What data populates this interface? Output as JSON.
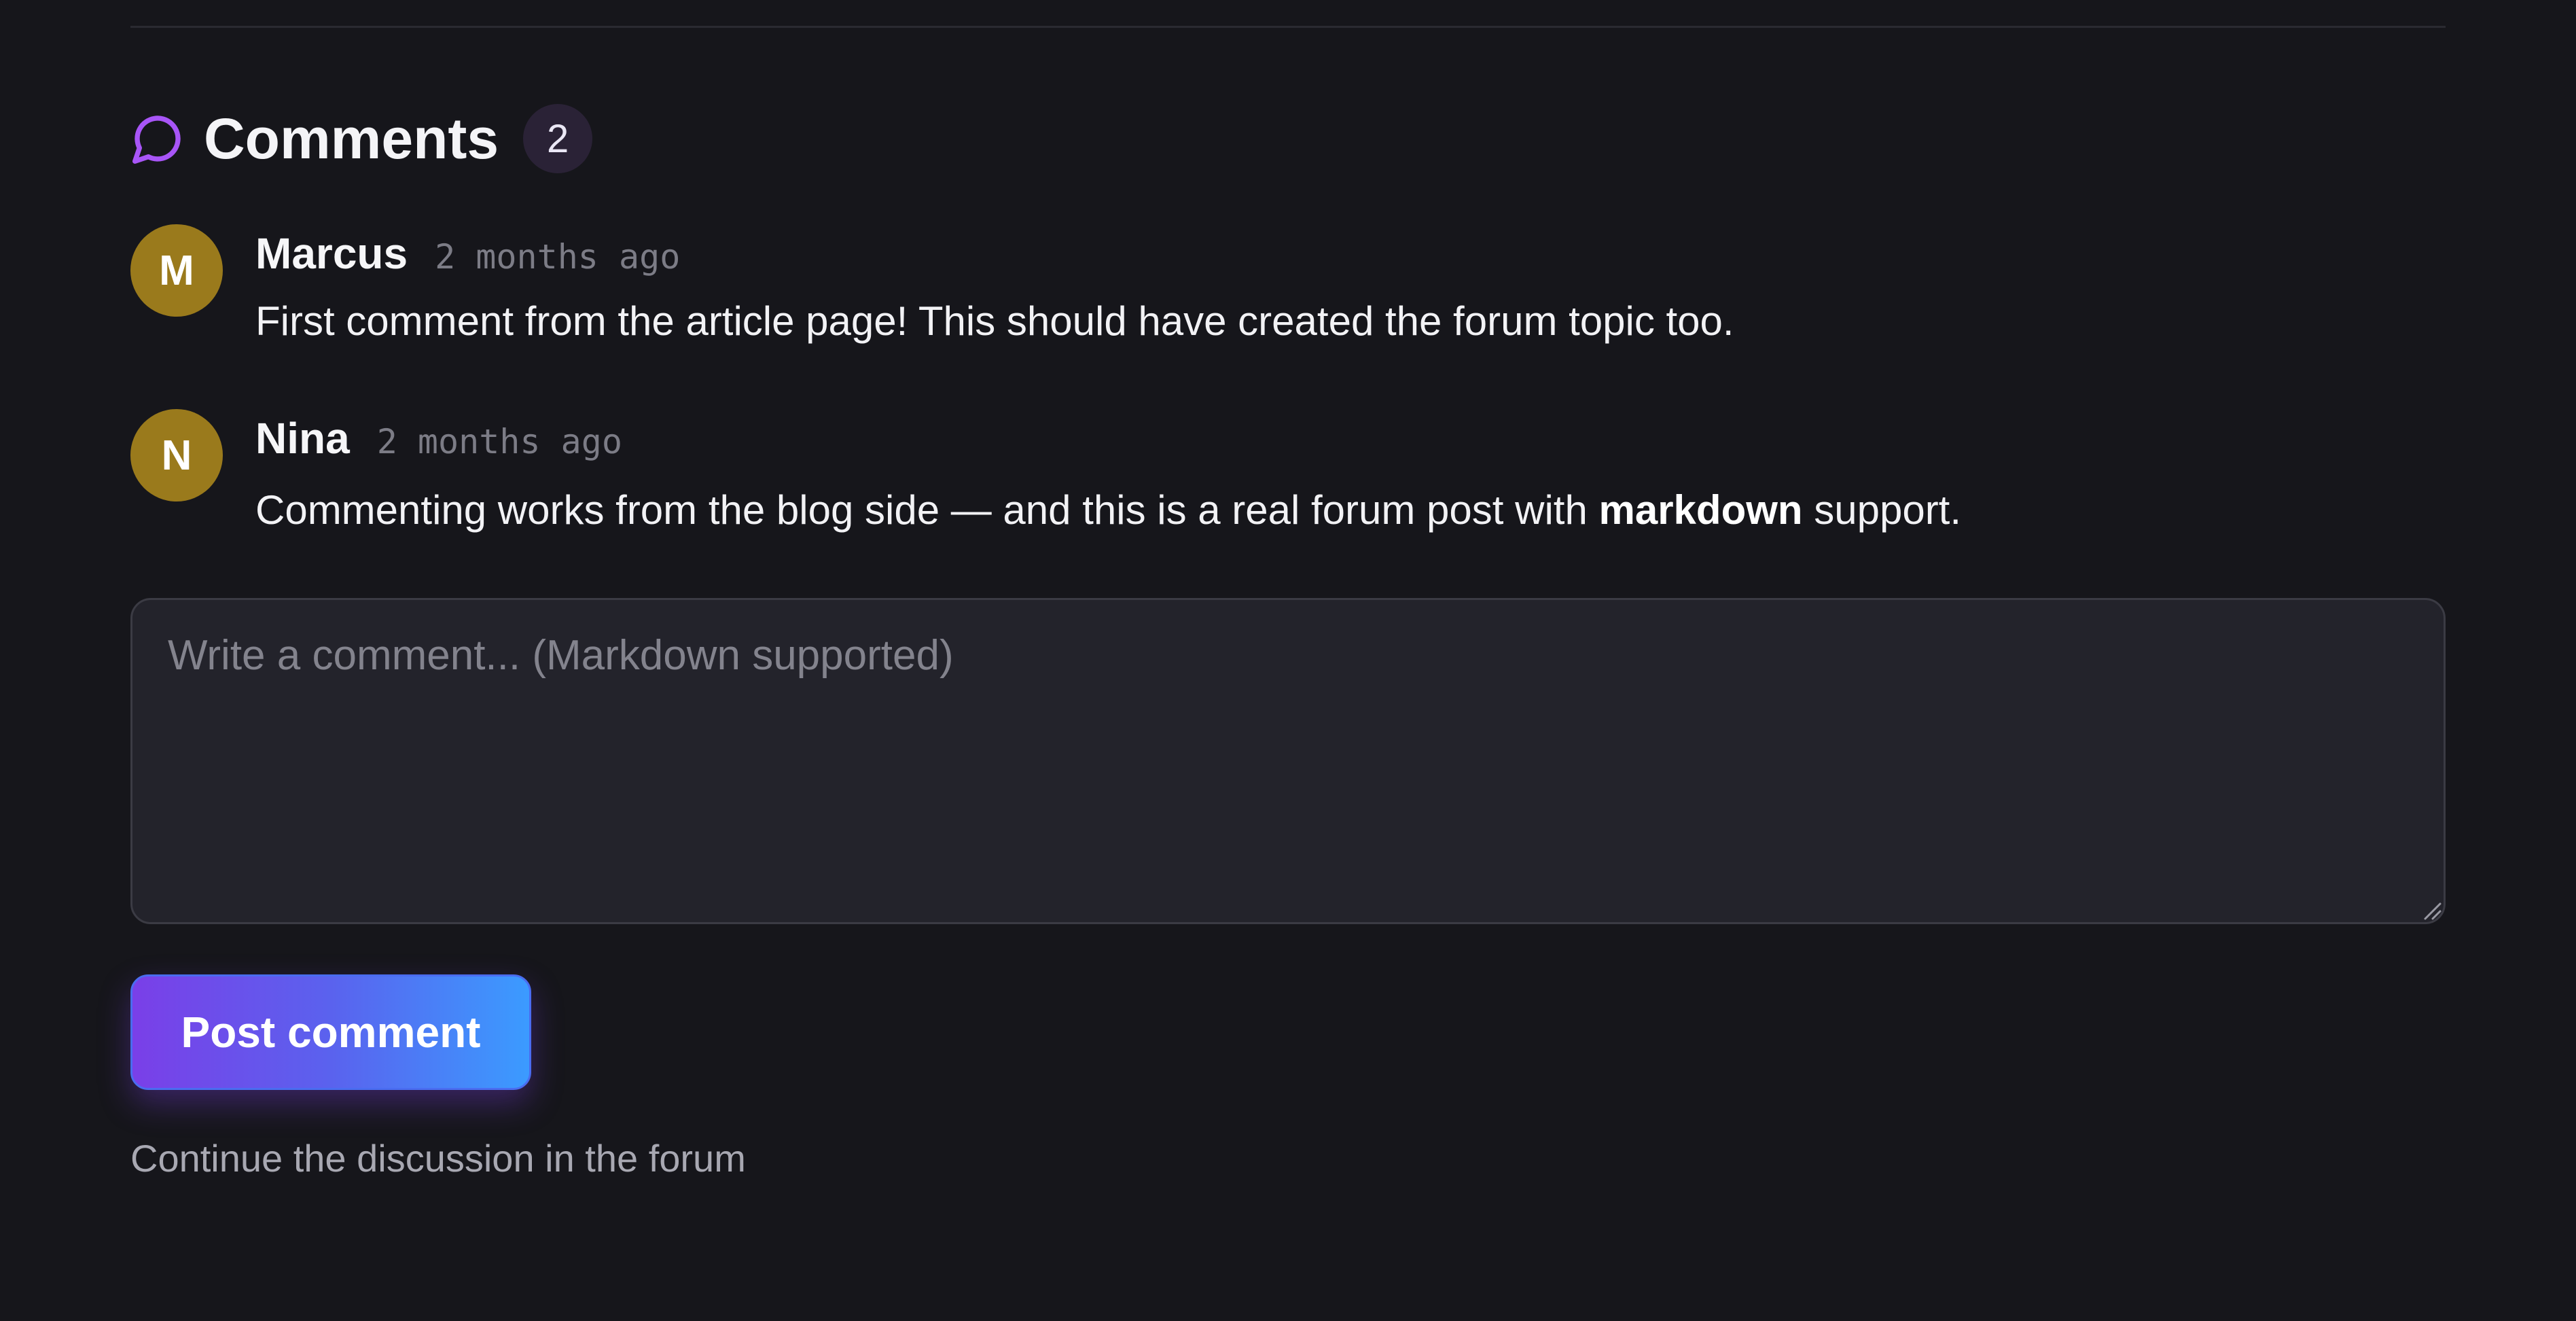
{
  "header": {
    "title": "Comments",
    "count": "2",
    "icon": "chat-bubble-icon",
    "icon_color": "#a855f7"
  },
  "comments": [
    {
      "avatar_initial": "M",
      "author": "Marcus",
      "time": "2 months ago",
      "body": "First comment from the article page! This should have created the forum topic too."
    },
    {
      "avatar_initial": "N",
      "author": "Nina",
      "time": "2 months ago",
      "body_before": "Commenting works from the blog side — and this is a real forum post with ",
      "body_bold": "markdown",
      "body_after": " support."
    }
  ],
  "composer": {
    "placeholder": "Write a comment... (Markdown supported)",
    "value": "",
    "submit_label": "Post comment"
  },
  "footer": {
    "forum_link": "Continue the discussion in the forum"
  },
  "colors": {
    "background": "#16161b",
    "avatar": "#9a7a1c",
    "button_gradient_start": "#7a3fe8",
    "button_gradient_end": "#3b9bff"
  }
}
